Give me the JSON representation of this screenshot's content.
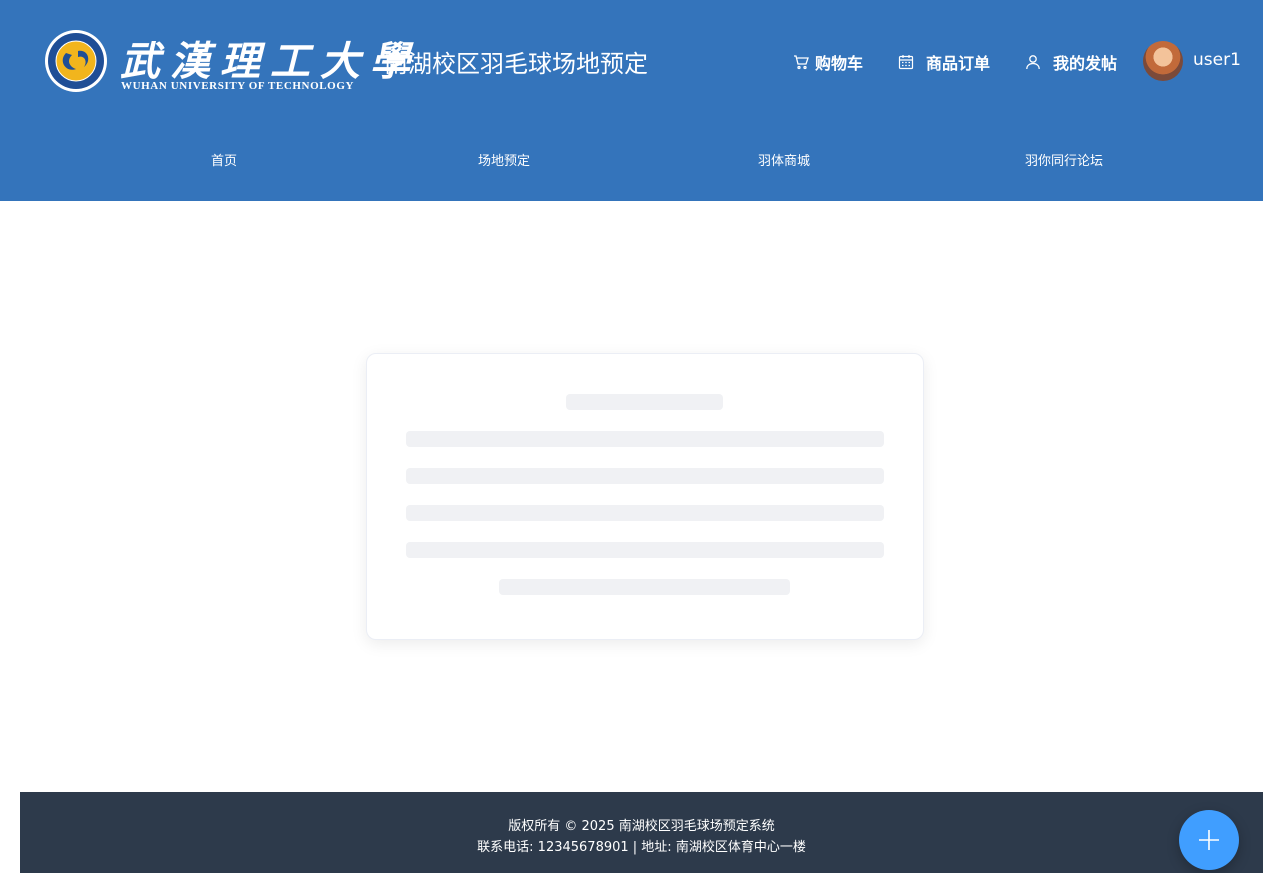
{
  "header": {
    "logo": {
      "chinese_name": "武漢理工大學",
      "english_name": "WUHAN UNIVERSITY OF TECHNOLOGY"
    },
    "site_title": "南湖校区羽毛球场地预定",
    "links": [
      {
        "label": "购物车",
        "icon": "cart-icon"
      },
      {
        "label": "商品订单",
        "icon": "calendar-icon"
      },
      {
        "label": "我的发帖",
        "icon": "user-icon"
      }
    ],
    "user": {
      "name": "user1"
    }
  },
  "nav": {
    "items": [
      {
        "label": "首页"
      },
      {
        "label": "场地预定"
      },
      {
        "label": "羽体商城"
      },
      {
        "label": "羽你同行论坛"
      }
    ]
  },
  "footer": {
    "copyright": "版权所有 © 2025 南湖校区羽毛球场预定系统",
    "contact": "联系电话: 12345678901 | 地址: 南湖校区体育中心一楼"
  },
  "fab": {
    "icon": "plus-icon"
  },
  "colors": {
    "header_bg": "#3474bb",
    "footer_bg": "#2d3a4b",
    "fab_bg": "#409eff",
    "skeleton": "#f0f1f4"
  }
}
